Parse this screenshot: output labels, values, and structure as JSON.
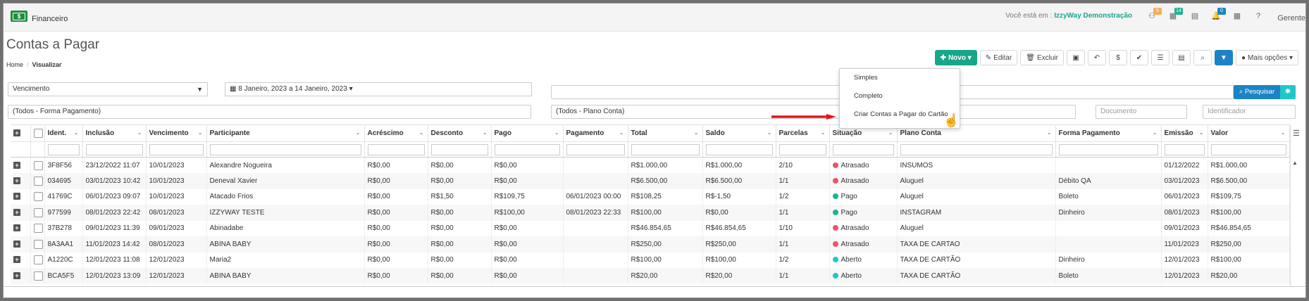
{
  "app": {
    "name": "Financeiro",
    "user": "Gerente"
  },
  "location": {
    "prefix": "Você está em :",
    "company": "IzzyWay Demonstração"
  },
  "top_icons": [
    {
      "icon": "sitemap-icon",
      "badge": "5",
      "badge_color": "#f8ac59"
    },
    {
      "icon": "building-icon",
      "badge": "14",
      "badge_color": "#1ab394"
    },
    {
      "icon": "list-icon",
      "badge": "",
      "badge_color": ""
    },
    {
      "icon": "bell-icon",
      "badge": "0",
      "badge_color": "#1c84c6"
    },
    {
      "icon": "calendar-icon",
      "badge": "",
      "badge_color": ""
    },
    {
      "icon": "help-icon",
      "badge": "",
      "badge_color": ""
    }
  ],
  "page": {
    "title": "Contas a Pagar",
    "breadcrumb": [
      "Home",
      "Visualizar"
    ]
  },
  "toolbar": {
    "novo": "Novo",
    "editar": "Editar",
    "excluir": "Excluir",
    "mais_opcoes": "Mais opções"
  },
  "dropdown": [
    "Simples",
    "Completo",
    "Criar Contas a Pagar do Cartão"
  ],
  "filters": {
    "date_field": "Vencimento",
    "date_range": "8 Janeiro, 2023 a 14 Janeiro, 2023",
    "search_value": "",
    "search_button": "Pesquisar",
    "forma_pagamento": "(Todos - Forma Pagamento)",
    "plano_conta": "(Todos - Plano Conta)",
    "documento_placeholder": "Documento",
    "identificador_placeholder": "Identificador"
  },
  "colors": {
    "primary": "#18a689",
    "info": "#1c84c6",
    "atrasado": "#ed5565",
    "pago": "#1ab394",
    "aberto": "#23c6c8"
  },
  "table": {
    "columns": [
      "Ident.",
      "Inclusão",
      "Vencimento",
      "Participante",
      "Acréscimo",
      "Desconto",
      "Pago",
      "Pagamento",
      "Total",
      "Saldo",
      "Parcelas",
      "Situação",
      "Plano Conta",
      "Forma Pagamento",
      "Emissão",
      "Valor"
    ],
    "rows": [
      [
        "3F8F56",
        "23/12/2022 11:07",
        "10/01/2023",
        "Alexandre Nogueira",
        "R$0,00",
        "R$0,00",
        "R$0,00",
        "",
        "R$1.000,00",
        "R$1.000,00",
        "2/10",
        "Atrasado",
        "INSUMOS",
        "",
        "01/12/2022",
        "R$1.000,00"
      ],
      [
        "034695",
        "03/01/2023 10:42",
        "10/01/2023",
        "Deneval Xavier",
        "R$0,00",
        "R$0,00",
        "R$0,00",
        "",
        "R$6.500,00",
        "R$6.500,00",
        "1/1",
        "Atrasado",
        "Aluguel",
        "Débito QA",
        "03/01/2023",
        "R$6.500,00"
      ],
      [
        "41769C",
        "06/01/2023 09:07",
        "10/01/2023",
        "Atacado Frios",
        "R$0,00",
        "R$1,50",
        "R$109,75",
        "06/01/2023 00:00",
        "R$108,25",
        "R$-1,50",
        "1/2",
        "Pago",
        "Aluguel",
        "Boleto",
        "06/01/2023",
        "R$109,75"
      ],
      [
        "977599",
        "08/01/2023 22:42",
        "08/01/2023",
        "IZZYWAY TESTE",
        "R$0,00",
        "R$0,00",
        "R$100,00",
        "08/01/2023 22:33",
        "R$100,00",
        "R$0,00",
        "1/1",
        "Pago",
        "INSTAGRAM",
        "Dinheiro",
        "08/01/2023",
        "R$100,00"
      ],
      [
        "37B278",
        "09/01/2023 11:39",
        "09/01/2023",
        "Abinadabe",
        "R$0,00",
        "R$0,00",
        "R$0,00",
        "",
        "R$46.854,65",
        "R$46.854,65",
        "1/10",
        "Atrasado",
        "Aluguel",
        "",
        "09/01/2023",
        "R$46.854,65"
      ],
      [
        "8A3AA1",
        "11/01/2023 14:42",
        "08/01/2023",
        "ABINA BABY",
        "R$0,00",
        "R$0,00",
        "R$0,00",
        "",
        "R$250,00",
        "R$250,00",
        "1/1",
        "Atrasado",
        "TAXA DE CARTAO",
        "",
        "11/01/2023",
        "R$250,00"
      ],
      [
        "A1220C",
        "12/01/2023 11:08",
        "12/01/2023",
        "Maria2",
        "R$0,00",
        "R$0,00",
        "R$0,00",
        "",
        "R$100,00",
        "R$100,00",
        "1/2",
        "Aberto",
        "TAXA DE CARTÃO",
        "Dinheiro",
        "12/01/2023",
        "R$100,00"
      ],
      [
        "BCA5F5",
        "12/01/2023 13:09",
        "12/01/2023",
        "ABINA BABY",
        "R$0,00",
        "R$0,00",
        "R$0,00",
        "",
        "R$20,00",
        "R$20,00",
        "1/1",
        "Aberto",
        "TAXA DE CARTÃO",
        "Boleto",
        "12/01/2023",
        "R$20,00"
      ]
    ]
  }
}
